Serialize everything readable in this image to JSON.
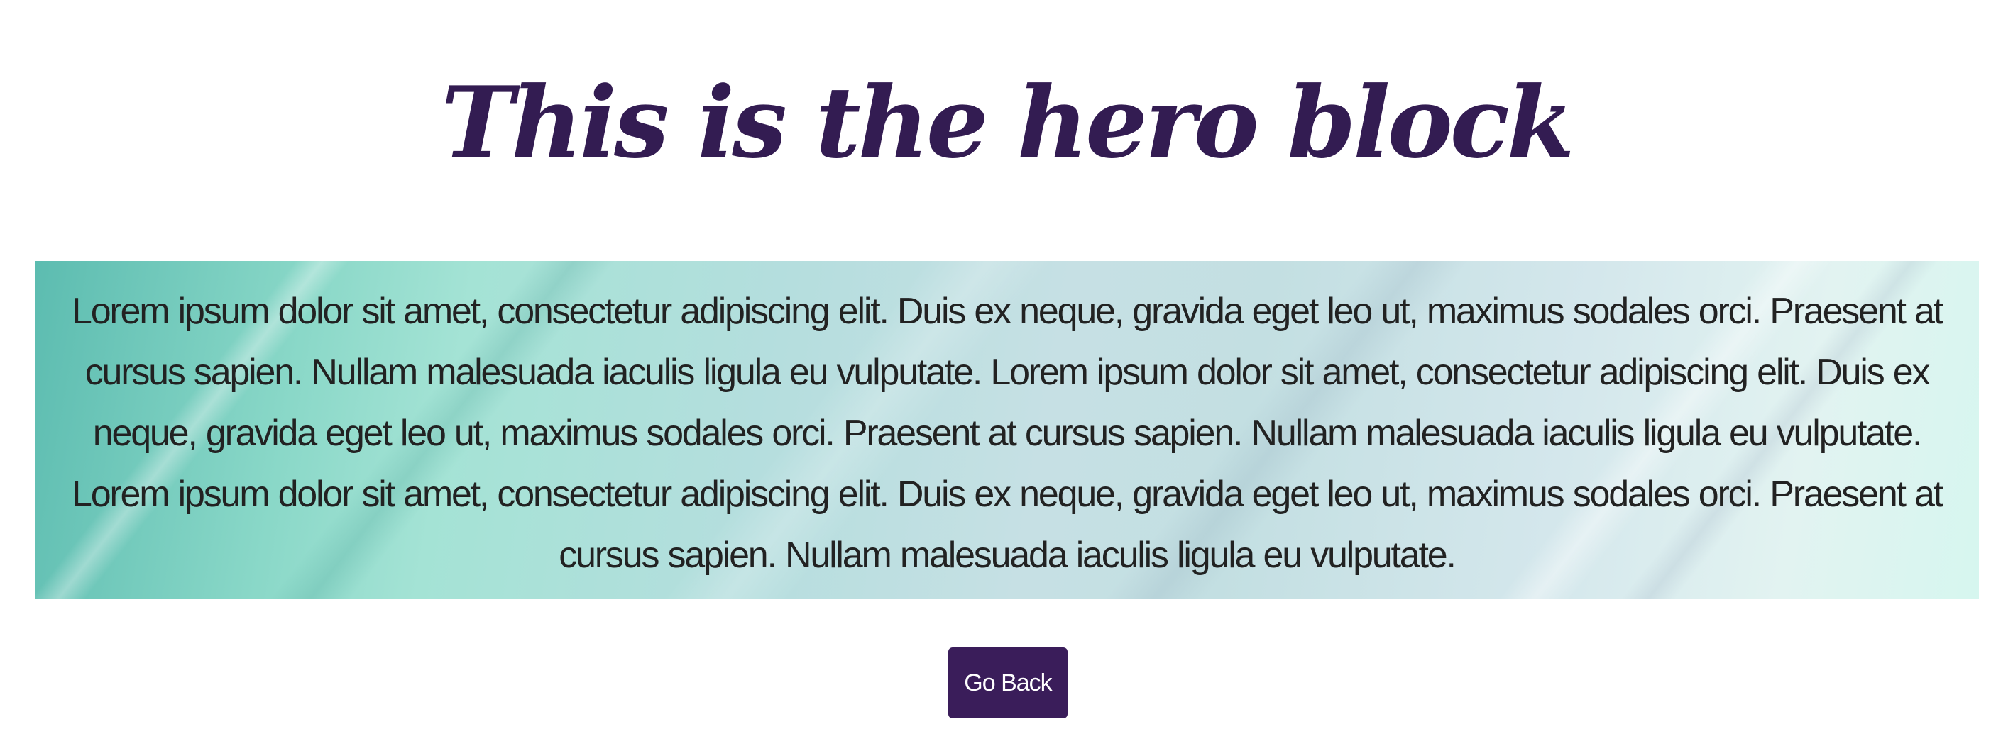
{
  "hero": {
    "title": "This is the hero block",
    "body": "Lorem ipsum dolor sit amet, consectetur adipiscing elit. Duis ex neque, gravida eget leo ut, maximus sodales orci. Praesent at cursus sapien. Nullam malesuada iaculis ligula eu vulputate. Lorem ipsum dolor sit amet, consectetur adipiscing elit. Duis ex neque, gravida eget leo ut, maximus sodales orci. Praesent at cursus sapien. Nullam malesuada iaculis ligula eu vulputate. Lorem ipsum dolor sit amet, consectetur adipiscing elit. Duis ex neque, gravida eget leo ut, maximus sodales orci. Praesent at cursus sapien. Nullam malesuada iaculis ligula eu vulputate."
  },
  "actions": {
    "go_back_label": "Go Back"
  },
  "colors": {
    "title": "#331c52",
    "button_background": "#3a1d5a",
    "button_text": "#ffffff",
    "body_text": "#222222"
  }
}
